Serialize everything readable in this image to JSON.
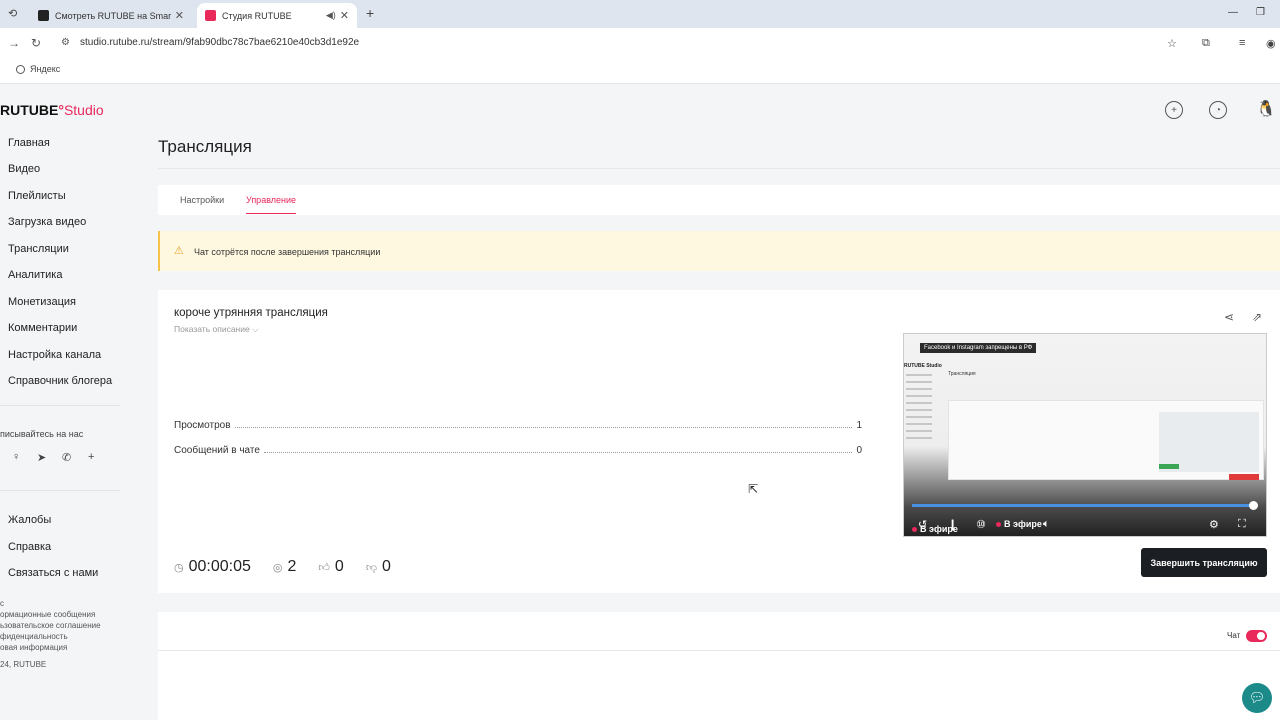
{
  "browser": {
    "tabs": [
      {
        "title": "Смотреть RUTUBE на Smart TV",
        "active": false
      },
      {
        "title": "Студия RUTUBE",
        "active": true
      }
    ],
    "url": "studio.rutube.ru/stream/9fab90dbc78c7bae6210e40cb3d1e92e",
    "bookmarks": [
      "Яндекс"
    ]
  },
  "logo": {
    "brand": "RUTUBE",
    "product": "Studio"
  },
  "sidebar": {
    "items": [
      {
        "label": "Главная"
      },
      {
        "label": "Видео"
      },
      {
        "label": "Плейлисты"
      },
      {
        "label": "Загрузка видео"
      },
      {
        "label": "Трансляции"
      },
      {
        "label": "Аналитика"
      },
      {
        "label": "Монетизация"
      },
      {
        "label": "Комментарии"
      },
      {
        "label": "Настройка канала"
      },
      {
        "label": "Справочник блогера"
      }
    ],
    "follow_text": "писывайтесь на нас",
    "social_icons": [
      "odnoklassniki-icon",
      "telegram-icon",
      "viber-icon",
      "plus-icon"
    ],
    "secondary": [
      {
        "label": "Жалобы"
      },
      {
        "label": "Справка"
      },
      {
        "label": "Связаться с нами"
      }
    ],
    "footer": [
      "с",
      "ормационные сообщения",
      "ьзовательское соглашение",
      "фиденциальность",
      "овая информация",
      "24, RUTUBE"
    ]
  },
  "page": {
    "title": "Трансляция",
    "tabs": [
      {
        "label": "Настройки",
        "active": false
      },
      {
        "label": "Управление",
        "active": true
      }
    ],
    "warning": "Чат сотрётся после завершения трансляции"
  },
  "stream": {
    "title": "короче утрянняя трансляция",
    "show_description": "Показать описание",
    "stats": [
      {
        "label": "Просмотров",
        "value": "1"
      },
      {
        "label": "Сообщений в чате",
        "value": "0"
      }
    ],
    "duration": "00:00:05",
    "viewers": "2",
    "likes": "0",
    "dislikes": "0",
    "end_button": "Завершить трансляцию"
  },
  "player": {
    "banner": "Facebook и Instagram запрещены в РФ",
    "live_label": "В эфире",
    "live_label_overlay": "В эфире",
    "preview_logo": "RUTUBE Studio",
    "preview_title": "Трансляция",
    "progress": 0.98
  },
  "chat": {
    "label": "Чат",
    "enabled": true
  },
  "colors": {
    "accent": "#e8295a",
    "button_dark": "#1b1f24",
    "warning_bg": "#fff8e1",
    "support": "#1d8a8a"
  }
}
